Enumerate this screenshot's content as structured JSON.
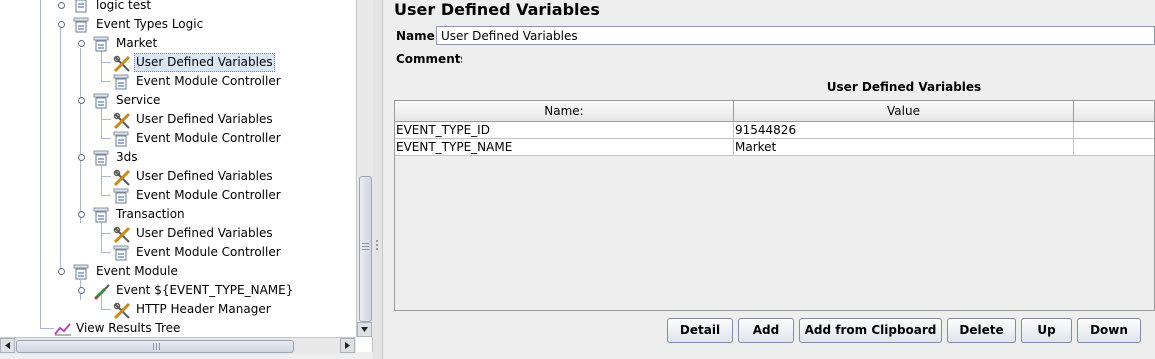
{
  "tree": {
    "items": [
      {
        "label": "logic test",
        "icon": "test-fragment-icon"
      },
      {
        "label": "Event Types Logic",
        "icon": "controller-icon"
      },
      {
        "label": "Market",
        "icon": "controller-icon"
      },
      {
        "label": "User Defined Variables",
        "icon": "config-wrench-icon",
        "selected": true
      },
      {
        "label": "Event Module Controller",
        "icon": "controller-icon"
      },
      {
        "label": "Service",
        "icon": "controller-icon"
      },
      {
        "label": "User Defined Variables",
        "icon": "config-wrench-icon"
      },
      {
        "label": "Event Module Controller",
        "icon": "controller-icon"
      },
      {
        "label": "3ds",
        "icon": "controller-icon"
      },
      {
        "label": "User Defined Variables",
        "icon": "config-wrench-icon"
      },
      {
        "label": "Event Module Controller",
        "icon": "controller-icon"
      },
      {
        "label": "Transaction",
        "icon": "controller-icon"
      },
      {
        "label": "User Defined Variables",
        "icon": "config-wrench-icon"
      },
      {
        "label": "Event Module Controller",
        "icon": "controller-icon"
      },
      {
        "label": "Event Module",
        "icon": "controller-icon"
      },
      {
        "label": "Event ${EVENT_TYPE_NAME}",
        "icon": "sampler-pipette-icon"
      },
      {
        "label": "HTTP Header Manager",
        "icon": "config-wrench-icon"
      },
      {
        "label": "View Results Tree",
        "icon": "listener-chart-icon"
      }
    ]
  },
  "panel": {
    "title": "User Defined Variables",
    "name_label": "Name:",
    "name_value": "User Defined Variables",
    "comments_label": "Comments:",
    "table_title": "User Defined Variables",
    "columns": [
      "Name:",
      "Value",
      ""
    ],
    "rows": [
      [
        "EVENT_TYPE_ID",
        "91544826",
        ""
      ],
      [
        "EVENT_TYPE_NAME",
        "Market",
        ""
      ]
    ]
  },
  "buttons": {
    "detail": "Detail",
    "add": "Add",
    "add_from_clipboard": "Add from Clipboard",
    "delete": "Delete",
    "up": "Up",
    "down": "Down"
  },
  "colors": {
    "selection": "#dbe6f4",
    "background": "#eeeeee",
    "button_border": "#7e8ea6"
  }
}
